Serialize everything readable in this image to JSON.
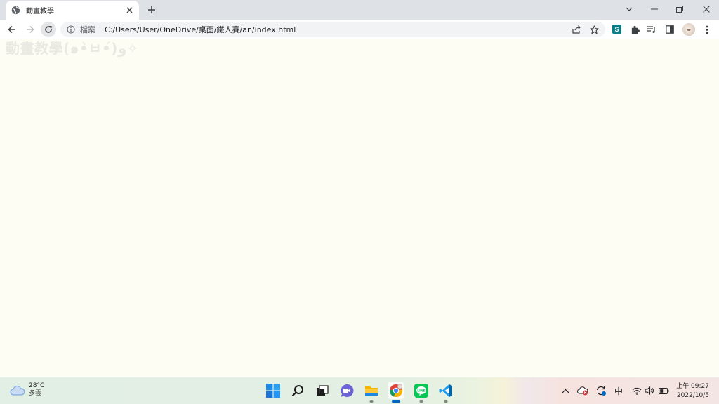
{
  "browser": {
    "tab": {
      "title": "動畫教學",
      "favicon": "globe-icon"
    },
    "omnibox": {
      "scheme_label": "檔案",
      "url": "C:/Users/User/OneDrive/桌面/鐵人賽/an/index.html"
    }
  },
  "page": {
    "heading": "動畫教學(๑•̀ㅂ•́)و✧"
  },
  "taskbar": {
    "weather": {
      "temperature": "28°C",
      "condition": "多雲"
    },
    "apps": [
      "windows-start",
      "search",
      "task-view",
      "teams-chat",
      "file-explorer",
      "chrome",
      "line",
      "vscode"
    ],
    "input_language": "中",
    "clock": {
      "time": "上午 09:27",
      "date": "2022/10/5"
    }
  },
  "colors": {
    "page_background": "#fdfdf3",
    "heading_color": "#e9e9e2",
    "taskbar_active": "#0067c0"
  }
}
